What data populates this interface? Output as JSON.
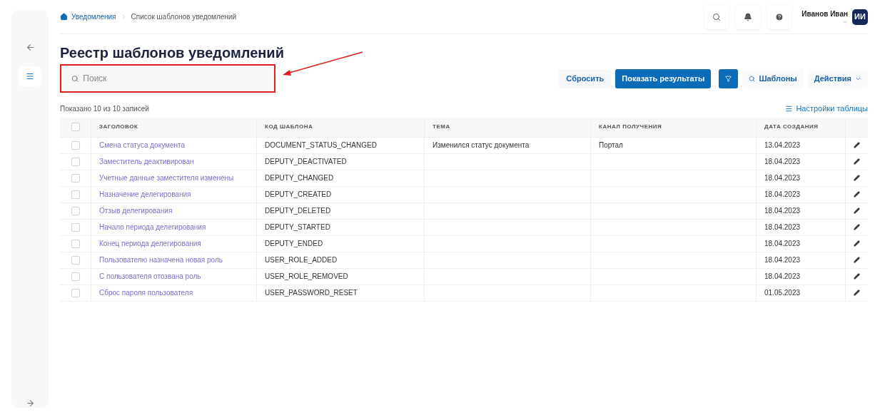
{
  "breadcrumbs": [
    {
      "label": "Уведомления",
      "kind": "link"
    },
    {
      "label": "Список шаблонов уведомлений",
      "kind": "current"
    }
  ],
  "user": {
    "name": "Иванов Иван",
    "initials": "ИИ"
  },
  "title": "Реестр шаблонов уведомлений",
  "search": {
    "placeholder": "Поиск"
  },
  "buttons": {
    "reset": "Сбросить",
    "show": "Показать результаты",
    "templates": "Шаблоны",
    "actions": "Действия"
  },
  "summary": "Показано 10 из 10 записей",
  "table_settings": "Настройки таблицы",
  "table": {
    "all_checked": false,
    "columns": [
      "ЗАГОЛОВОК",
      "КОД ШАБЛОНА",
      "ТЕМА",
      "КАНАЛ ПОЛУЧЕНИЯ",
      "ДАТА СОЗДАНИЯ"
    ],
    "rows": [
      {
        "checked": false,
        "title": "Смена статуса документа",
        "code": "DOCUMENT_STATUS_CHANGED",
        "subject": "Изменился статус документа",
        "channel": "Портал",
        "date": "13.04.2023"
      },
      {
        "checked": false,
        "title": "Заместитель деактивирован",
        "code": "DEPUTY_DEACTIVATED",
        "date": "18.04.2023"
      },
      {
        "checked": false,
        "title": "Учетные данные заместителя изменены",
        "code": "DEPUTY_CHANGED",
        "date": "18.04.2023"
      },
      {
        "checked": false,
        "title": "Назначение делегирования",
        "code": "DEPUTY_CREATED",
        "date": "18.04.2023"
      },
      {
        "checked": false,
        "title": "Отзыв делегирования",
        "code": "DEPUTY_DELETED",
        "date": "18.04.2023"
      },
      {
        "checked": false,
        "title": "Начало периода делегирования",
        "code": "DEPUTY_STARTED",
        "date": "18.04.2023"
      },
      {
        "checked": false,
        "title": "Конец периода делегирования",
        "code": "DEPUTY_ENDED",
        "date": "18.04.2023"
      },
      {
        "checked": false,
        "title": "Пользователю назначена новая роль",
        "code": "USER_ROLE_ADDED",
        "date": "18.04.2023"
      },
      {
        "checked": false,
        "title": "С пользователя отозвана роль",
        "code": "USER_ROLE_REMOVED",
        "date": "18.04.2023"
      },
      {
        "checked": false,
        "title": "Сброс пароля пользователя",
        "code": "USER_PASSWORD_RESET",
        "date": "01.05.2023"
      }
    ]
  }
}
